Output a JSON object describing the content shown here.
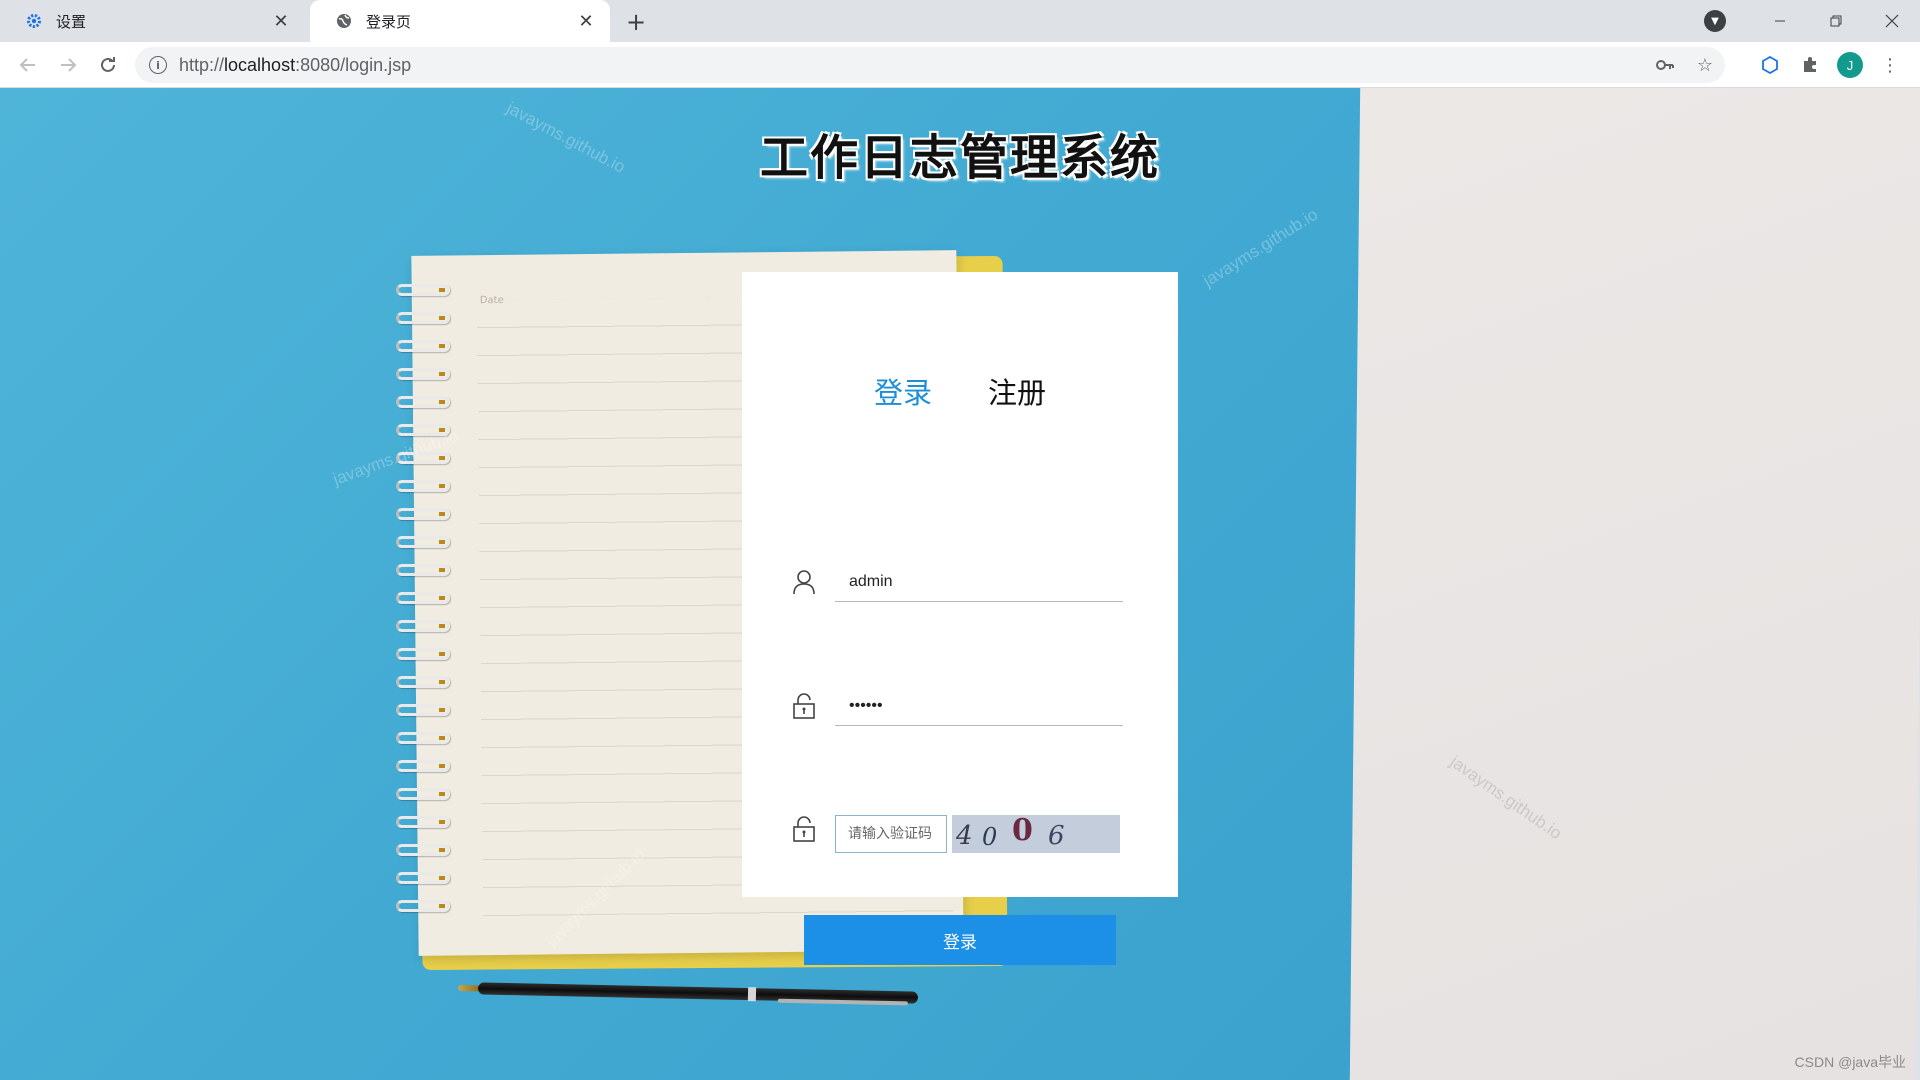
{
  "browser": {
    "tabs": [
      {
        "title": "设置",
        "icon": "gear-icon"
      },
      {
        "title": "登录页",
        "icon": "globe-icon"
      }
    ],
    "new_tab_symbol": "+",
    "url_prefix": "http://",
    "url_host": "localhost",
    "url_rest": ":8080/login.jsp",
    "profile_initial": "J"
  },
  "page": {
    "title": "工作日志管理系统",
    "tabs": {
      "login": "登录",
      "register": "注册"
    },
    "username_value": "admin",
    "password_value": "••••••",
    "captcha_placeholder": "请输入验证码",
    "captcha_chars": [
      "4",
      "0",
      "0",
      "6"
    ],
    "submit_label": "登录",
    "notebook_date_label": "Date",
    "watermark": "javayms.github.io",
    "footer_credit": "CSDN @java毕业"
  },
  "colors": {
    "accent": "#1b8fd8",
    "button": "#1c8fe6",
    "background_blue": "#4fb4d8"
  }
}
